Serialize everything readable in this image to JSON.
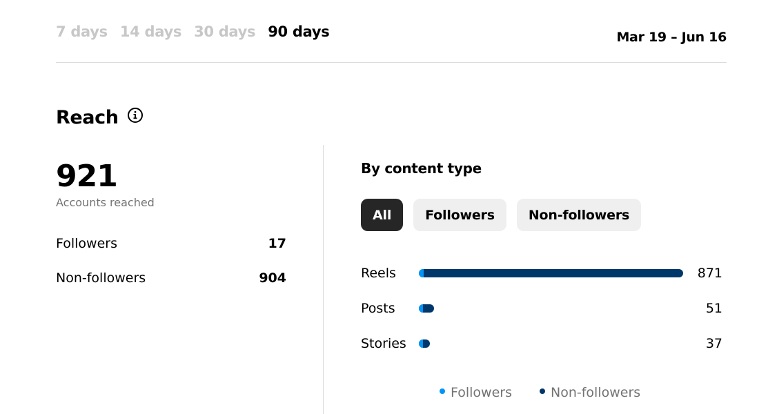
{
  "range_tabs": [
    {
      "label": "7 days",
      "active": false
    },
    {
      "label": "14 days",
      "active": false
    },
    {
      "label": "30 days",
      "active": false
    },
    {
      "label": "90 days",
      "active": true
    }
  ],
  "date_range": "Mar 19 – Jun 16",
  "reach": {
    "title": "Reach",
    "info_icon": "info-circle-icon",
    "total": "921",
    "total_label": "Accounts reached",
    "breakdown": [
      {
        "label": "Followers",
        "value": "17"
      },
      {
        "label": "Non-followers",
        "value": "904"
      }
    ]
  },
  "content_type": {
    "title": "By content type",
    "filters": [
      {
        "label": "All",
        "active": true
      },
      {
        "label": "Followers",
        "active": false
      },
      {
        "label": "Non-followers",
        "active": false
      }
    ],
    "legend": [
      {
        "label": "Followers",
        "color": "#0095f6"
      },
      {
        "label": "Non-followers",
        "color": "#00376b"
      }
    ]
  },
  "colors": {
    "followers": "#0095f6",
    "non_followers": "#00376b",
    "active_chip": "#262626",
    "chip": "#efefef"
  },
  "chart_data": {
    "type": "bar",
    "orientation": "horizontal",
    "stacked": true,
    "categories": [
      "Reels",
      "Posts",
      "Stories"
    ],
    "totals": [
      871,
      51,
      37
    ],
    "series": [
      {
        "name": "Followers",
        "values": [
          16,
          1,
          1
        ]
      },
      {
        "name": "Non-followers",
        "values": [
          855,
          50,
          36
        ]
      }
    ]
  }
}
